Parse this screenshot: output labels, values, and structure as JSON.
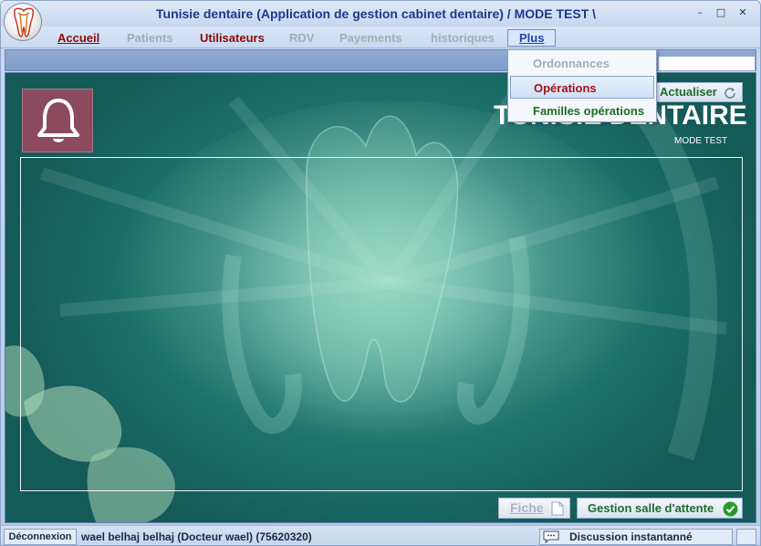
{
  "window": {
    "title": "Tunisie dentaire (Application de gestion cabinet dentaire) / MODE TEST \\",
    "minimize": "–",
    "maximize": "□",
    "close": "✕"
  },
  "menu": {
    "accueil": "Accueil",
    "patients": "Patients",
    "utilisateurs": "Utilisateurs",
    "rdv": "RDV",
    "payements": "Payements",
    "historiques": "historiques",
    "plus": "Plus"
  },
  "dropdown": {
    "items": [
      {
        "label": "Ordonnances",
        "state": "disabled"
      },
      {
        "label": "Opérations",
        "state": "highlighted"
      },
      {
        "label": "Familles opérations",
        "state": "enabled"
      }
    ]
  },
  "main": {
    "refresh_label": "Actualiser",
    "brand_title": "TUNISIE DENTAIRE",
    "brand_subtitle": "MODE TEST",
    "fiche_label": "Fiche",
    "gestion_label": "Gestion salle d'attente"
  },
  "status": {
    "deconnexion": "Déconnexion",
    "user": "wael belhaj belhaj (Docteur wael) (75620320)",
    "chat": "Discussion instantanné"
  },
  "colors": {
    "accent_red": "#8b0a0a",
    "accent_green": "#1f6b2a",
    "title_blue": "#1a3a8a",
    "panel_teal": "#237a72"
  }
}
